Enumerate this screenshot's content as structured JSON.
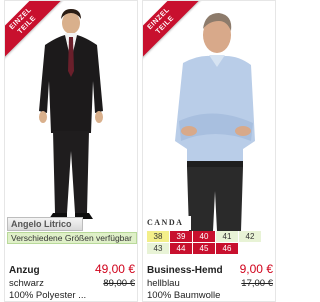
{
  "products": [
    {
      "badge": [
        "EINZEL",
        "TEILE"
      ],
      "brand": "Angelo Litrico",
      "availability": "Verschiedene Größen verfügbar",
      "name": "Anzug",
      "color": "schwarz",
      "material": "100% Polyester ...",
      "price": "49,00 €",
      "old_price": "89,00 €"
    },
    {
      "badge": [
        "EINZEL",
        "TEILE"
      ],
      "brand": "CANDA",
      "sizes": [
        [
          {
            "label": "38",
            "state": "selected"
          },
          {
            "label": "39",
            "state": "soldout"
          },
          {
            "label": "40",
            "state": "soldout"
          },
          {
            "label": "41",
            "state": "available"
          },
          {
            "label": "42",
            "state": "available"
          }
        ],
        [
          {
            "label": "43",
            "state": "available"
          },
          {
            "label": "44",
            "state": "soldout"
          },
          {
            "label": "45",
            "state": "soldout"
          },
          {
            "label": "46",
            "state": "soldout"
          }
        ]
      ],
      "name": "Business-Hemd",
      "color": "hellblau",
      "material": "100% Baumwolle",
      "price": "9,00 €",
      "old_price": "17,00 €"
    }
  ],
  "colors": {
    "accent": "#c8102e",
    "available": "#e8f3d6",
    "selected": "#f3ef8a"
  }
}
